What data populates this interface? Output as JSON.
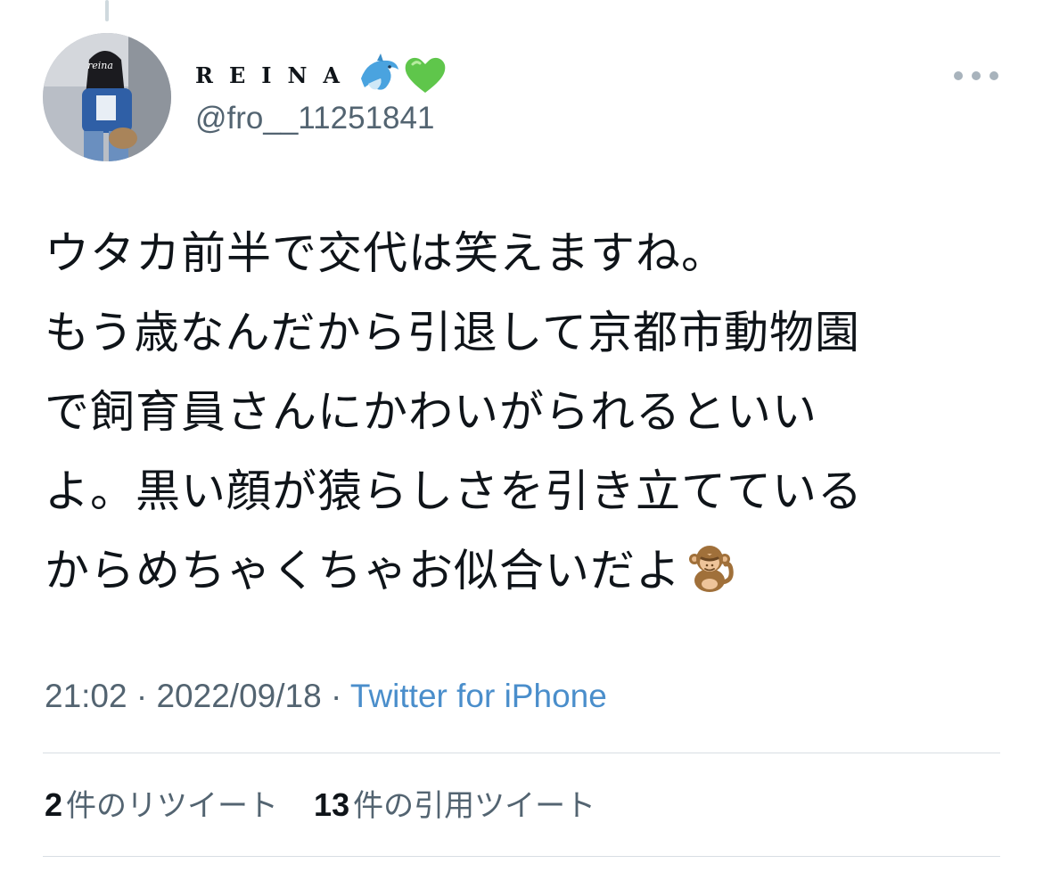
{
  "user": {
    "display_name": "REINA",
    "name_emojis": [
      "dolphin-emoji",
      "green-heart-emoji"
    ],
    "handle": "@fro__11251841",
    "avatar_caption": "reina"
  },
  "tweet": {
    "text_lines": [
      "ウタカ前半で交代は笑えますね。",
      "もう歳なんだから引退して京都市動物園",
      "で飼育員さんにかわいがられるといい",
      "よ。黒い顔が猿らしさを引き立てている",
      "からめちゃくちゃお似合いだよ"
    ],
    "trailing_emoji": "monkey-emoji"
  },
  "meta": {
    "time": "21:02",
    "separator": " · ",
    "date": "2022/09/18",
    "source": "Twitter for iPhone"
  },
  "stats": {
    "retweets_count": "2",
    "retweets_label": "件のリツイート",
    "quotes_count": "13",
    "quotes_label": "件の引用ツイート"
  },
  "colors": {
    "text": "#0f1419",
    "secondary": "#536471",
    "link": "#4a8ecb",
    "divider": "#d8dee3"
  }
}
